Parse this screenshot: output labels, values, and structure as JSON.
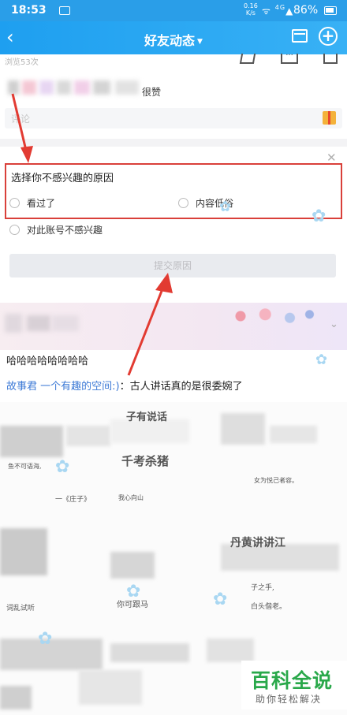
{
  "status_bar": {
    "time": "18:53",
    "net_speed": "0.16",
    "net_unit": "K/s",
    "signal": "4G",
    "battery": "86%"
  },
  "nav": {
    "back_icon": "back-arrow-icon",
    "title": "好友动态",
    "caret": "▼"
  },
  "post_top": {
    "browse_count": "浏览53次",
    "likes_suffix": "很赞",
    "comment_placeholder": "评论"
  },
  "feedback": {
    "title": "选择你不感兴趣的原因",
    "options": [
      "看过了",
      "内容低俗",
      "对此账号不感兴趣"
    ],
    "submit_label": "提交原因"
  },
  "next_post": {
    "title": "哈哈哈哈哈哈哈哈",
    "link_text": "故事君 一个有趣的空间:)",
    "desc_text": "：古人讲话真的是很委婉了"
  },
  "image_glyphs": {
    "g1": "子有说话",
    "g2": "鱼不可语海,",
    "g3": "千考杀猪",
    "g4": "一《庄子》",
    "g5": "我心向山",
    "g6": "女为悦己者容。",
    "g7": "丹黄讲讲江",
    "g8": "子之手,",
    "g9": "你可跟马",
    "g10": "白头偕老。",
    "g11": "词乱试听"
  },
  "watermark": {
    "big": "百科全说",
    "small": "助你轻松解决"
  },
  "colors": {
    "nav_blue": "#2a9ee8",
    "highlight_red": "#d9403a",
    "watermark_green": "#29a84a",
    "link_blue": "#3d7ad6"
  }
}
